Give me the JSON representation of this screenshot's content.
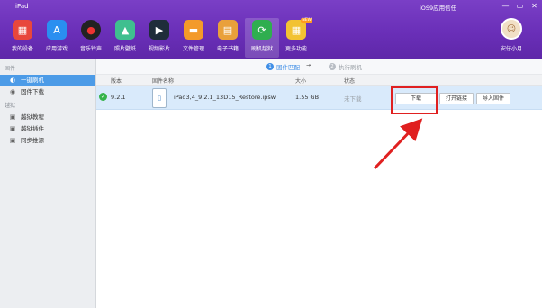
{
  "titlebar": {
    "device_name": "iPad",
    "trust_text": "iOS9应用信任"
  },
  "window_controls": {
    "min_label": "—",
    "max_label": "▭",
    "close_label": "✕"
  },
  "nav": {
    "items": [
      {
        "label": "我的设备",
        "icon": "device-store-icon",
        "color": "#e8473c"
      },
      {
        "label": "应用游戏",
        "icon": "app-store-icon",
        "color": "#2a8ff0"
      },
      {
        "label": "音乐铃声",
        "icon": "music-disc-icon",
        "color": "#222222"
      },
      {
        "label": "照片壁纸",
        "icon": "photo-icon",
        "color": "#3fbf8f"
      },
      {
        "label": "视频影片",
        "icon": "video-clapper-icon",
        "color": "#1f2d3a"
      },
      {
        "label": "文件管理",
        "icon": "folder-icon",
        "color": "#f39a2a"
      },
      {
        "label": "电子书籍",
        "icon": "book-icon",
        "color": "#e9a03b"
      },
      {
        "label": "刷机越狱",
        "icon": "refresh-icon",
        "color": "#2fae4f"
      },
      {
        "label": "更多功能",
        "icon": "more-apps-icon",
        "color": "#f2c233"
      }
    ],
    "badge": "NEW"
  },
  "user": {
    "name": "安仔小月"
  },
  "sidebar": {
    "section_firmware": "固件",
    "firmware_items": [
      {
        "label": "一键刷机",
        "icon": "flash-icon"
      },
      {
        "label": "固件下载",
        "icon": "download-icon"
      }
    ],
    "section_jailbreak": "越狱",
    "jailbreak_items": [
      {
        "label": "越狱教程",
        "icon": "tutorial-icon"
      },
      {
        "label": "越狱插件",
        "icon": "plugin-icon"
      },
      {
        "label": "同步推源",
        "icon": "source-icon"
      }
    ]
  },
  "steps": [
    {
      "num": "1",
      "label": "固件匹配",
      "color": "#3f8ee6"
    },
    {
      "num": "2",
      "label": "执行刷机",
      "color": "#b7bcc3"
    }
  ],
  "table": {
    "headers": [
      "版本",
      "固件名称",
      "大小",
      "状态"
    ],
    "rows": [
      {
        "version": "9.2.1",
        "name": "iPad3,4_9.2.1_13D15_Restore.ipsw",
        "size": "1.55 GB",
        "status": "未下载"
      }
    ],
    "buttons": {
      "download": "下载",
      "open_link": "打开链接",
      "import": "导入固件"
    }
  },
  "colors": {
    "header": "#6a2fb8",
    "selected": "#4c9be7",
    "annotation": "#e02020"
  }
}
